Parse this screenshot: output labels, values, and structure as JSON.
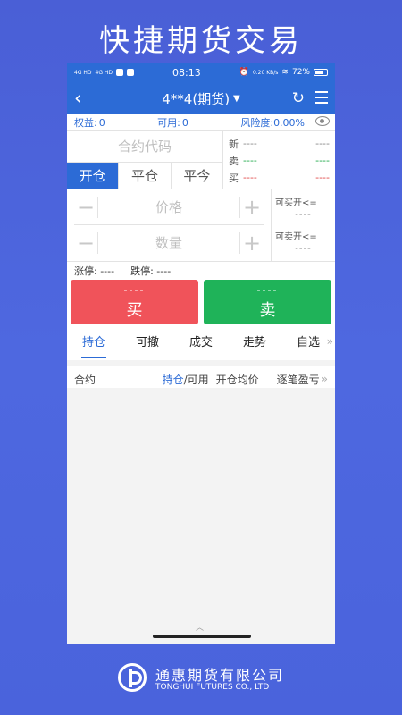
{
  "promo": {
    "headline": "快捷期货交易"
  },
  "status_bar": {
    "signal_1": "4G HD",
    "signal_2": "4G HD",
    "time": "08:13",
    "net_speed": "0.20 KB/s",
    "battery": "72%",
    "battery_level": 0.72
  },
  "nav": {
    "title": "4**4(期货)"
  },
  "account": {
    "equity_label": "权益:",
    "equity_value": "0",
    "available_label": "可用:",
    "available_value": "0",
    "risk_label": "风险度:",
    "risk_value": "0.00%"
  },
  "contract": {
    "placeholder": "合约代码"
  },
  "order_tabs": [
    "开仓",
    "平仓",
    "平今"
  ],
  "quote": {
    "rows": [
      {
        "label": "新",
        "v1": "----",
        "v2": "----"
      },
      {
        "label": "卖",
        "v1": "----",
        "v2": "----"
      },
      {
        "label": "买",
        "v1": "----",
        "v2": "----"
      }
    ]
  },
  "price": {
    "placeholder": "价格"
  },
  "quantity": {
    "placeholder": "数量"
  },
  "availability": {
    "buy_open_label": "可买开<=",
    "buy_open_value": "----",
    "sell_open_label": "可卖开<=",
    "sell_open_value": "----"
  },
  "limits": {
    "up_label": "涨停: ----",
    "down_label": "跌停: ----"
  },
  "trade": {
    "buy_price": "----",
    "buy_label": "买",
    "sell_price": "----",
    "sell_label": "卖"
  },
  "bottom_tabs": [
    "持仓",
    "可撤",
    "成交",
    "走势",
    "自选"
  ],
  "bottom_more": "»",
  "positions_header": {
    "contract": "合约",
    "hold_hl": "持仓",
    "hold_rest": "/可用",
    "avg_price": "开仓均价",
    "pnl": "逐笔盈亏",
    "more": "»"
  },
  "footer": {
    "company_cn": "通惠期货有限公司",
    "company_en": "TONGHUI FUTURES CO., LTD"
  },
  "colors": {
    "primary": "#2c6bd6",
    "buy": "#f0535a",
    "sell": "#1fb359",
    "background": "#4a5fd6"
  }
}
